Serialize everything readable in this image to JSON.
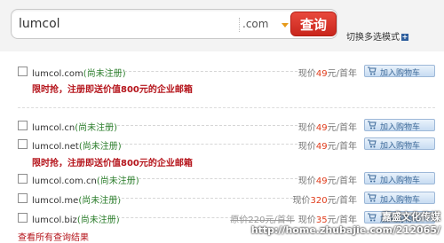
{
  "search": {
    "value": "lumcol",
    "tld": ".com",
    "button_label": "查询",
    "multi_toggle": "切换多选模式",
    "multi_toggle_icon": "plus-icon"
  },
  "price_prefix": "现价",
  "price_suffix": "元/首年",
  "cart_label": "加入购物车",
  "cart_icon": "cart-icon",
  "colors": {
    "accent": "#c9261c",
    "promo": "#b5141b",
    "price": "#e03b1a",
    "status": "#2b7d2b"
  },
  "rows": [
    {
      "domain": "lumcol.com",
      "status": "(尚未注册)",
      "price": "49"
    },
    {
      "domain": "lumcol.cn",
      "status": "(尚未注册)",
      "price": "49"
    },
    {
      "domain": "lumcol.net",
      "status": "(尚未注册)",
      "price": "49"
    },
    {
      "domain": "lumcol.com.cn",
      "status": "(尚未注册)",
      "price": "49"
    },
    {
      "domain": "lumcol.me",
      "status": "(尚未注册)",
      "price": "320"
    },
    {
      "domain": "lumcol.biz",
      "status": "(尚未注册)",
      "orig_price": "原价220元/首年",
      "price": "35"
    }
  ],
  "promo_text": "限时抢，注册即送价值800元的企业邮箱",
  "bottom_link": "查看所有查询结果",
  "watermark": {
    "line1": "嘉盛文化传媒",
    "line2": "http://home.zhubajie.com/212065/"
  }
}
